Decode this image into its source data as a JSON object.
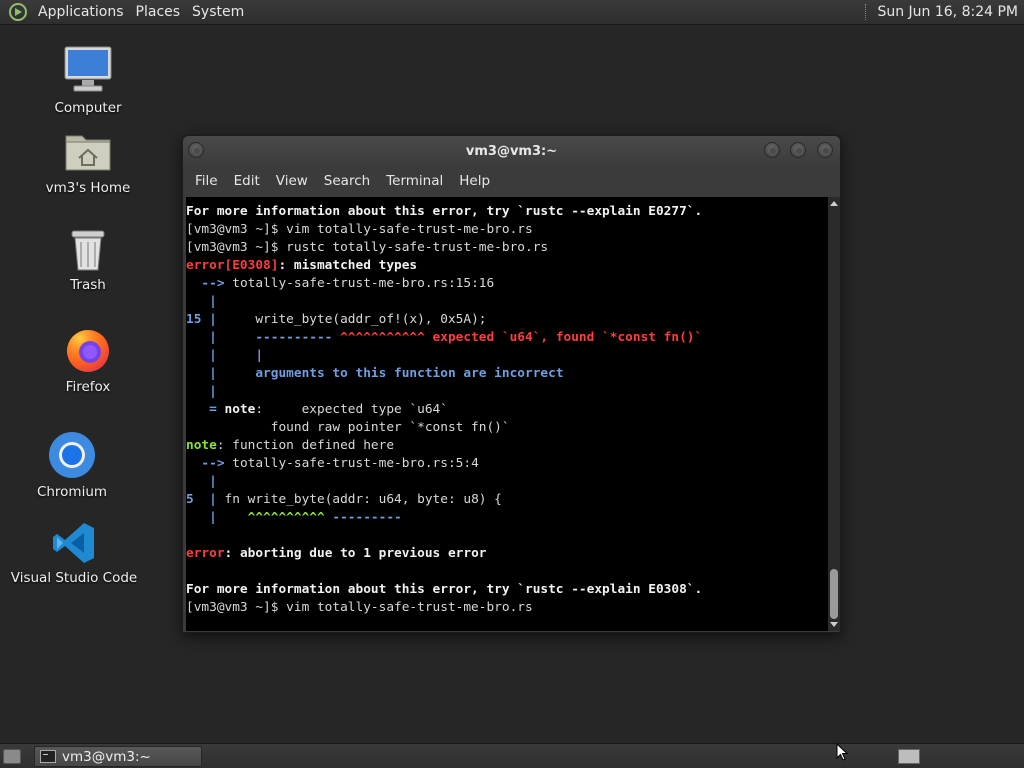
{
  "top_panel": {
    "menus": [
      "Applications",
      "Places",
      "System"
    ],
    "clock": "Sun Jun 16,  8:24 PM"
  },
  "desktop_icons": [
    {
      "label": "Computer",
      "icon": "computer-icon"
    },
    {
      "label": "vm3's Home",
      "icon": "home-folder-icon"
    },
    {
      "label": "Trash",
      "icon": "trash-icon"
    },
    {
      "label": "Firefox",
      "icon": "firefox-icon"
    },
    {
      "label": "Chromium",
      "icon": "chromium-icon"
    },
    {
      "label": "Visual Studio Code",
      "icon": "vscode-icon"
    }
  ],
  "terminal": {
    "title": "vm3@vm3:~",
    "menu": [
      "File",
      "Edit",
      "View",
      "Search",
      "Terminal",
      "Help"
    ],
    "lines": [
      {
        "segments": [
          {
            "t": "For more information about this error, try `rustc --explain E0277`.",
            "c": "b"
          }
        ]
      },
      {
        "segments": [
          {
            "t": "[vm3@vm3 ~]$ vim totally-safe-trust-me-bro.rs",
            "c": ""
          }
        ]
      },
      {
        "segments": [
          {
            "t": "[vm3@vm3 ~]$ rustc totally-safe-trust-me-bro.rs",
            "c": ""
          }
        ]
      },
      {
        "segments": [
          {
            "t": "error[E0308]",
            "c": "red"
          },
          {
            "t": ": mismatched types",
            "c": "b"
          }
        ]
      },
      {
        "segments": [
          {
            "t": "  --> ",
            "c": "blue"
          },
          {
            "t": "totally-safe-trust-me-bro.rs:15:16",
            "c": ""
          }
        ]
      },
      {
        "segments": [
          {
            "t": "   |",
            "c": "blue"
          }
        ]
      },
      {
        "segments": [
          {
            "t": "15 |",
            "c": "blue"
          },
          {
            "t": "     write_byte(addr_of!(x), 0x5A);",
            "c": ""
          }
        ]
      },
      {
        "segments": [
          {
            "t": "   |     ",
            "c": "blue"
          },
          {
            "t": "---------- ",
            "c": "blue"
          },
          {
            "t": "^^^^^^^^^^^ expected `u64`, found `*const fn()`",
            "c": "red"
          }
        ]
      },
      {
        "segments": [
          {
            "t": "   |     |",
            "c": "blue"
          }
        ]
      },
      {
        "segments": [
          {
            "t": "   |     ",
            "c": "blue"
          },
          {
            "t": "arguments to this function are incorrect",
            "c": "blue"
          }
        ]
      },
      {
        "segments": [
          {
            "t": "   |",
            "c": "blue"
          }
        ]
      },
      {
        "segments": [
          {
            "t": "   = ",
            "c": "blue"
          },
          {
            "t": "note",
            "c": "b"
          },
          {
            "t": ":     expected type `u64`",
            "c": ""
          }
        ]
      },
      {
        "segments": [
          {
            "t": "           found raw pointer `*const fn()`",
            "c": ""
          }
        ]
      },
      {
        "segments": [
          {
            "t": "note",
            "c": "green"
          },
          {
            "t": ": function defined here",
            "c": ""
          }
        ]
      },
      {
        "segments": [
          {
            "t": "  --> ",
            "c": "blue"
          },
          {
            "t": "totally-safe-trust-me-bro.rs:5:4",
            "c": ""
          }
        ]
      },
      {
        "segments": [
          {
            "t": "   |",
            "c": "blue"
          }
        ]
      },
      {
        "segments": [
          {
            "t": "5  |",
            "c": "blue"
          },
          {
            "t": " fn write_byte(addr: u64, byte: u8) {",
            "c": ""
          }
        ]
      },
      {
        "segments": [
          {
            "t": "   |    ",
            "c": "blue"
          },
          {
            "t": "^^^^^^^^^^",
            "c": "green"
          },
          {
            "t": " ---------",
            "c": "blue"
          }
        ]
      },
      {
        "segments": [
          {
            "t": "",
            "c": ""
          }
        ]
      },
      {
        "segments": [
          {
            "t": "error",
            "c": "red"
          },
          {
            "t": ": aborting due to 1 previous error",
            "c": "b"
          }
        ]
      },
      {
        "segments": [
          {
            "t": "",
            "c": ""
          }
        ]
      },
      {
        "segments": [
          {
            "t": "For more information about this error, try `rustc --explain E0308`.",
            "c": "b"
          }
        ]
      },
      {
        "segments": [
          {
            "t": "[vm3@vm3 ~]$ vim totally-safe-trust-me-bro.rs",
            "c": ""
          }
        ]
      }
    ]
  },
  "taskbar": {
    "task_label": "vm3@vm3:~"
  },
  "colors": {
    "error": "#ff3b3b",
    "info": "#6f9fe0",
    "note": "#8ae234"
  }
}
